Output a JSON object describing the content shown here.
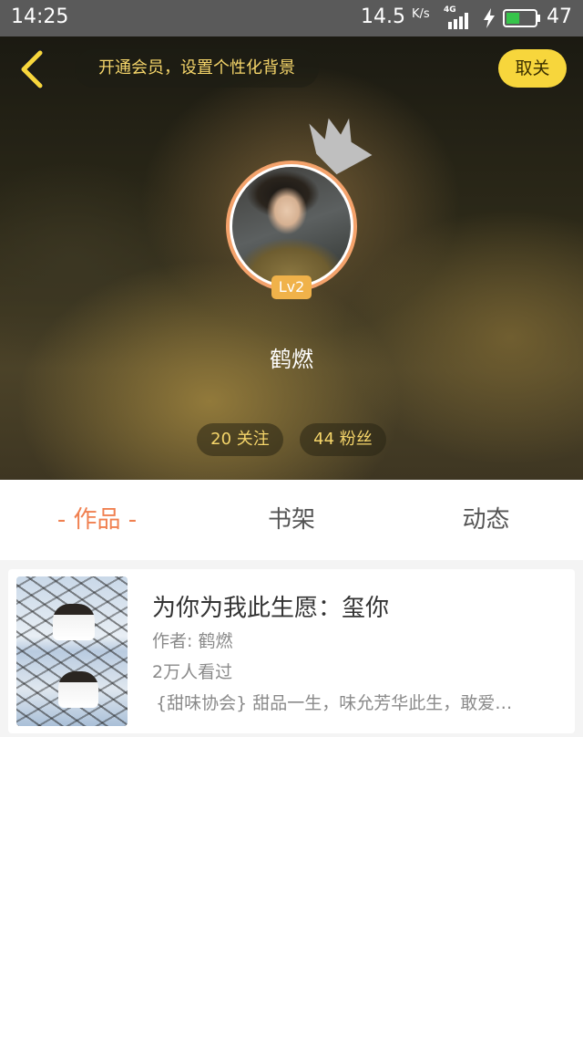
{
  "status_bar": {
    "time": "14:25",
    "network_speed": "14.5",
    "network_speed_unit": "K/s",
    "network_type": "4G",
    "battery_level": "47",
    "battery_fraction": 0.47
  },
  "header": {
    "vip_prompt": "开通会员，设置个性化背景",
    "unfollow_label": "取关",
    "level": "Lv2",
    "username": "鹤燃",
    "following": "20 关注",
    "fans": "44 粉丝",
    "accent_color": "#f7d63c"
  },
  "tabs": [
    {
      "label": "- 作品 -",
      "active": true
    },
    {
      "label": "书架",
      "active": false
    },
    {
      "label": "动态",
      "active": false
    }
  ],
  "works": [
    {
      "title": "为你为我此生愿：玺你",
      "author": "作者: 鹤燃",
      "views": "2万人看过",
      "description": "{甜味协会}  甜品一生，味允芳华此生，敢爱…"
    }
  ],
  "icons": {
    "back": "back-arrow-icon",
    "crown": "crown-icon",
    "signal": "signal-icon",
    "battery": "battery-icon",
    "charging": "bolt-icon"
  }
}
